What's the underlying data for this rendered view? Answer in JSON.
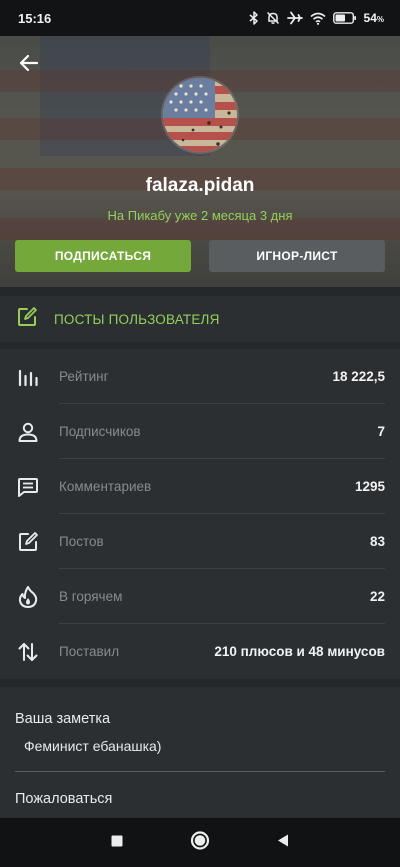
{
  "status_bar": {
    "time": "15:16",
    "battery_percent": "54",
    "battery_unit": "%",
    "icons": [
      "bluetooth-icon",
      "bell-off-icon",
      "airplane-icon",
      "wifi-icon",
      "battery-icon"
    ]
  },
  "header": {
    "back_icon": "arrow-left-icon",
    "username": "falaza.pidan",
    "member_since": "На Пикабу уже 2 месяца 3 дня",
    "subscribe_label": "ПОДПИСАТЬСЯ",
    "ignore_label": "ИГНОР-ЛИСТ"
  },
  "posts_link": {
    "icon": "edit-square-icon",
    "label": "ПОСТЫ ПОЛЬЗОВАТЕЛЯ"
  },
  "stats": [
    {
      "icon": "bar-chart-icon",
      "label": "Рейтинг",
      "value": "18 222,5"
    },
    {
      "icon": "person-icon",
      "label": "Подписчиков",
      "value": "7"
    },
    {
      "icon": "comment-icon",
      "label": "Комментариев",
      "value": "1295"
    },
    {
      "icon": "edit-square-icon",
      "label": "Постов",
      "value": "83"
    },
    {
      "icon": "flame-icon",
      "label": "В горячем",
      "value": "22"
    },
    {
      "icon": "swap-vertical-icon",
      "label": "Поставил",
      "value": "210 плюсов и 48 минусов"
    }
  ],
  "note": {
    "title": "Ваша заметка",
    "text": "Феминист ебанашка)",
    "report_label": "Пожаловаться"
  },
  "nav_bar": {
    "icons": [
      "square-icon",
      "circle-icon",
      "back-triangle-icon"
    ]
  },
  "colors": {
    "accent_green": "#95cf5a",
    "button_green": "#74a83b",
    "button_gray": "#5a5d60",
    "panel_bg": "#2b2f32",
    "page_bg": "#24282b"
  }
}
